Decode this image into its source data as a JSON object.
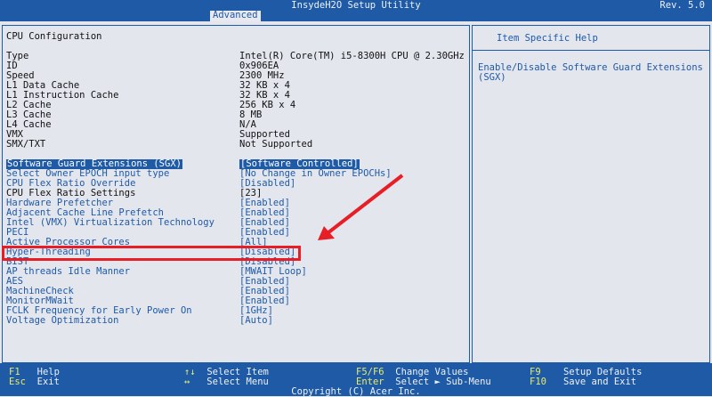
{
  "title": "InsydeH2O Setup Utility",
  "revision": "Rev. 5.0",
  "tabs": [
    {
      "label": "Advanced",
      "active": true
    }
  ],
  "section_title": "CPU Configuration",
  "info_rows": [
    {
      "label": "Type",
      "value": "Intel(R) Core(TM) i5-8300H CPU @ 2.30GHz"
    },
    {
      "label": "ID",
      "value": "0x906EA"
    },
    {
      "label": "Speed",
      "value": "2300 MHz"
    },
    {
      "label": "L1 Data Cache",
      "value": "32 KB x 4"
    },
    {
      "label": "L1 Instruction Cache",
      "value": "32 KB x 4"
    },
    {
      "label": "L2 Cache",
      "value": "256 KB x 4"
    },
    {
      "label": "L3 Cache",
      "value": "8 MB"
    },
    {
      "label": "L4 Cache",
      "value": "N/A"
    },
    {
      "label": "VMX",
      "value": "Supported"
    },
    {
      "label": "SMX/TXT",
      "value": "Not Supported"
    }
  ],
  "options": [
    {
      "label": "Software Guard Extensions (SGX)",
      "value": "[Software Controlled]",
      "selected": true
    },
    {
      "label": "Select Owner EPOCH input type",
      "value": "[No Change in Owner EPOCHs]"
    },
    {
      "label": "CPU Flex Ratio Override",
      "value": "[Disabled]"
    },
    {
      "label": "CPU Flex Ratio Settings",
      "value": "[23]",
      "info": true
    },
    {
      "label": "Hardware Prefetcher",
      "value": "[Enabled]"
    },
    {
      "label": "Adjacent Cache Line Prefetch",
      "value": "[Enabled]"
    },
    {
      "label": "Intel (VMX) Virtualization Technology",
      "value": "[Enabled]"
    },
    {
      "label": "PECI",
      "value": "[Enabled]"
    },
    {
      "label": "Active Processor Cores",
      "value": "[All]"
    },
    {
      "label": "Hyper-Threading",
      "value": "[Disabled]"
    },
    {
      "label": "BIST",
      "value": "[Disabled]"
    },
    {
      "label": "AP threads Idle Manner",
      "value": "[MWAIT Loop]"
    },
    {
      "label": "AES",
      "value": "[Enabled]"
    },
    {
      "label": "MachineCheck",
      "value": "[Enabled]"
    },
    {
      "label": "MonitorMWait",
      "value": "[Enabled]"
    },
    {
      "label": "FCLK Frequency for Early Power On",
      "value": "[1GHz]"
    },
    {
      "label": "Voltage Optimization",
      "value": "[Auto]"
    }
  ],
  "help": {
    "title": "Item Specific Help",
    "text": "Enable/Disable Software Guard Extensions\n(SGX)"
  },
  "status_keys": [
    {
      "key": "F1",
      "desc": "Help"
    },
    {
      "key": "Esc",
      "desc": "Exit"
    },
    {
      "key": "↑↓",
      "desc": "Select Item"
    },
    {
      "key": "↔",
      "desc": "Select Menu"
    },
    {
      "key": "F5/F6",
      "desc": "Change Values"
    },
    {
      "key": "Enter",
      "desc": "Select ► Sub-Menu"
    },
    {
      "key": "F9",
      "desc": "Setup Defaults"
    },
    {
      "key": "F10",
      "desc": "Save and Exit"
    }
  ],
  "copyright": "Copyright (C) Acer Inc.",
  "colors": {
    "accent": "#1e5aa6",
    "background": "#e4e6ee",
    "highlight": "#e81e26"
  }
}
